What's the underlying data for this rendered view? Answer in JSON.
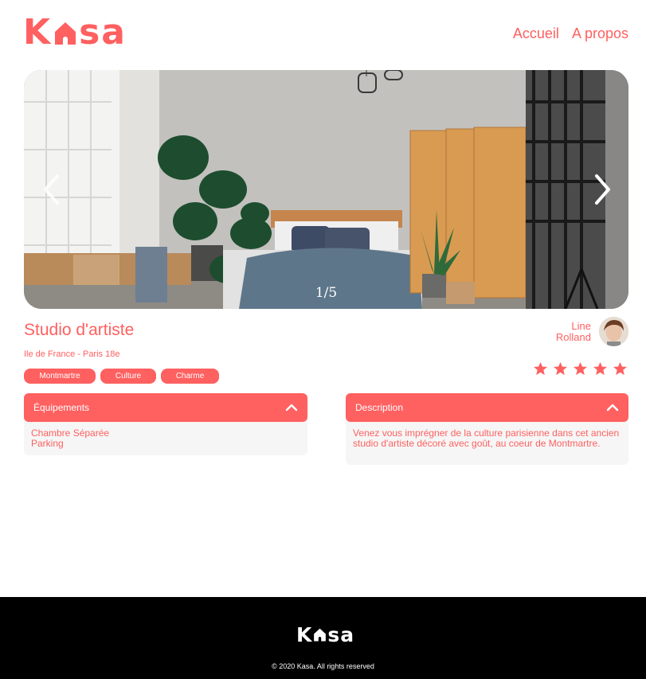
{
  "header": {
    "logo_prefix": "K",
    "logo_suffix": "sa",
    "nav": [
      {
        "label": "Accueil"
      },
      {
        "label": "A propos"
      }
    ]
  },
  "carousel": {
    "counter": "1/5",
    "current": 1,
    "total": 5
  },
  "listing": {
    "title": "Studio d'artiste",
    "location": "Ile de France - Paris 18e",
    "tags": [
      "Montmartre",
      "Culture",
      "Charme"
    ],
    "host": {
      "first_name": "Line",
      "last_name": "Rolland"
    },
    "rating": 5,
    "rating_max": 5
  },
  "collapses": {
    "equipments": {
      "label": "Équipements",
      "items": [
        "Chambre Séparée",
        "Parking"
      ]
    },
    "description": {
      "label": "Description",
      "text": "Venez vous imprégner de la culture parisienne dans cet ancien studio d'artiste décoré avec goût, au coeur de Montmartre."
    }
  },
  "footer": {
    "logo_prefix": "K",
    "logo_suffix": "sa",
    "copyright": "© 2020 Kasa. All rights reserved"
  },
  "colors": {
    "accent": "#FF6060",
    "panel": "#F6F6F6",
    "footer_bg": "#000000"
  }
}
